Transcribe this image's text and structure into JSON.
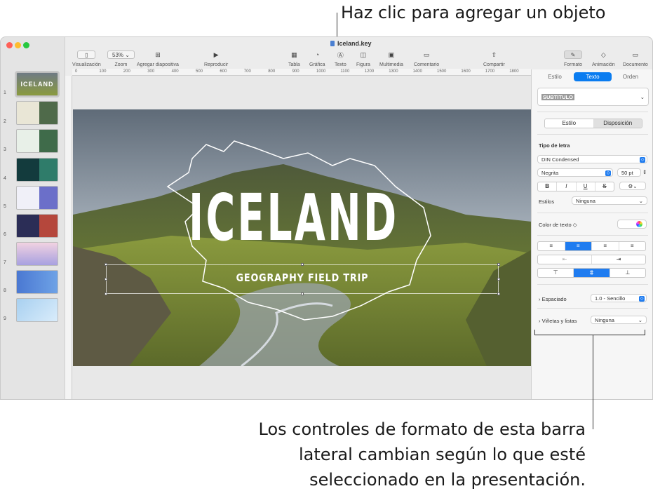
{
  "callouts": {
    "top": "Haz clic para agregar un objeto",
    "bottom_lines": [
      "Los controles de formato de esta barra",
      "lateral cambian según lo que esté",
      "seleccionado en la presentación."
    ]
  },
  "window": {
    "title": "Iceland.key"
  },
  "toolbar": {
    "view": "Visualización",
    "zoom_value": "53%",
    "zoom": "Zoom",
    "add_slide": "Agregar diapositiva",
    "play": "Reproducir",
    "table": "Tabla",
    "chart": "Gráfica",
    "text": "Texto",
    "shape": "Figura",
    "media": "Multimedia",
    "comment": "Comentario",
    "share": "Compartir",
    "format": "Formato",
    "animate": "Animación",
    "document": "Documento"
  },
  "ruler": [
    "0",
    "100",
    "200",
    "300",
    "400",
    "500",
    "600",
    "700",
    "800",
    "900",
    "1000",
    "1100",
    "1200",
    "1300",
    "1400",
    "1500",
    "1600",
    "1700",
    "1800"
  ],
  "slides": {
    "numbers": [
      "1",
      "2",
      "3",
      "4",
      "5",
      "6",
      "7",
      "8",
      "9"
    ],
    "thumb1_title": "ICELAND"
  },
  "slide": {
    "title": "ICELAND",
    "subtitle": "GEOGRAPHY FIELD TRIP"
  },
  "inspector": {
    "tabs": [
      "Estilo",
      "Texto",
      "Orden"
    ],
    "paragraph_style": "SUBTITULO",
    "seg_style": "Estilo",
    "seg_layout": "Disposición",
    "font_label": "Tipo de letra",
    "font_name": "DIN Condensed",
    "font_weight": "Negrita",
    "font_size": "50 pt",
    "styles_label": "Estilos",
    "styles_value": "Ninguna",
    "color_label": "Color de texto ◇",
    "spacing_label": "Espaciado",
    "spacing_value": "1.0 - Sencillo",
    "bullets_label": "Viñetas y listas",
    "bullets_value": "Ninguna",
    "bold": "B",
    "italic": "I",
    "underline": "U",
    "strike": "S"
  },
  "colors": {
    "accent": "#0a7cf0",
    "sky": "#8b97a3",
    "hills": "#7a8a3a"
  }
}
